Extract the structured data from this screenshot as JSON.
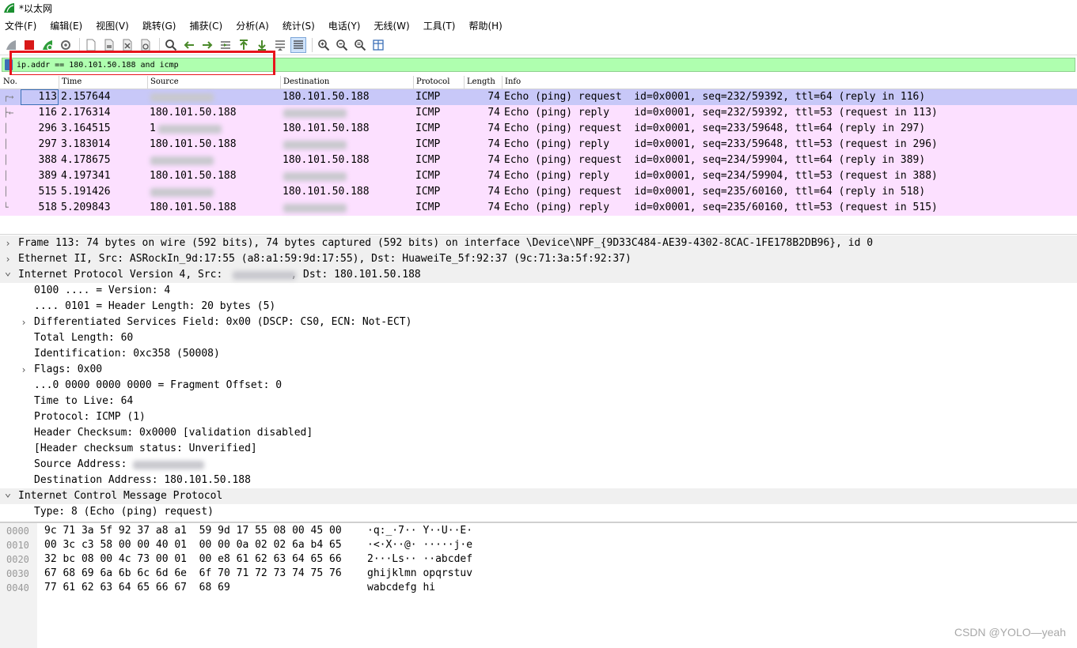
{
  "window": {
    "title": "*以太网"
  },
  "menu": [
    "文件(F)",
    "编辑(E)",
    "视图(V)",
    "跳转(G)",
    "捕获(C)",
    "分析(A)",
    "统计(S)",
    "电话(Y)",
    "无线(W)",
    "工具(T)",
    "帮助(H)"
  ],
  "filter": {
    "value": "ip.addr == 180.101.50.188 and icmp"
  },
  "columns": {
    "no": "No.",
    "time": "Time",
    "source": "Source",
    "destination": "Destination",
    "protocol": "Protocol",
    "length": "Length",
    "info": "Info"
  },
  "colors": {
    "selected_row": "#c8c8f8",
    "icmp_row": "#fce0ff",
    "filter_valid": "#afffaf",
    "highlight_box": "#e8141b"
  },
  "packets": [
    {
      "no": "113",
      "time": "2.157644",
      "source": "",
      "destination": "180.101.50.188",
      "protocol": "ICMP",
      "length": "74",
      "info": "Echo (ping) request  id=0x0001, seq=232/59392, ttl=64 (reply in 116)",
      "selected": true
    },
    {
      "no": "116",
      "time": "2.176314",
      "source": "180.101.50.188",
      "destination": "",
      "protocol": "ICMP",
      "length": "74",
      "info": "Echo (ping) reply    id=0x0001, seq=232/59392, ttl=53 (request in 113)",
      "selected": false
    },
    {
      "no": "296",
      "time": "3.164515",
      "source": "1",
      "destination": "180.101.50.188",
      "protocol": "ICMP",
      "length": "74",
      "info": "Echo (ping) request  id=0x0001, seq=233/59648, ttl=64 (reply in 297)",
      "selected": false
    },
    {
      "no": "297",
      "time": "3.183014",
      "source": "180.101.50.188",
      "destination": "",
      "protocol": "ICMP",
      "length": "74",
      "info": "Echo (ping) reply    id=0x0001, seq=233/59648, ttl=53 (request in 296)",
      "selected": false
    },
    {
      "no": "388",
      "time": "4.178675",
      "source": "",
      "destination": "180.101.50.188",
      "protocol": "ICMP",
      "length": "74",
      "info": "Echo (ping) request  id=0x0001, seq=234/59904, ttl=64 (reply in 389)",
      "selected": false
    },
    {
      "no": "389",
      "time": "4.197341",
      "source": "180.101.50.188",
      "destination": "",
      "protocol": "ICMP",
      "length": "74",
      "info": "Echo (ping) reply    id=0x0001, seq=234/59904, ttl=53 (request in 388)",
      "selected": false
    },
    {
      "no": "515",
      "time": "5.191426",
      "source": "",
      "destination": "180.101.50.188",
      "protocol": "ICMP",
      "length": "74",
      "info": "Echo (ping) request  id=0x0001, seq=235/60160, ttl=64 (reply in 518)",
      "selected": false
    },
    {
      "no": "518",
      "time": "5.209843",
      "source": "180.101.50.188",
      "destination": "",
      "protocol": "ICMP",
      "length": "74",
      "info": "Echo (ping) reply    id=0x0001, seq=235/60160, ttl=53 (request in 515)",
      "selected": false
    }
  ],
  "details": [
    {
      "text": "Frame 113: 74 bytes on wire (592 bits), 74 bytes captured (592 bits) on interface \\Device\\NPF_{9D33C484-AE39-4302-8CAC-1FE178B2DB96}, id 0",
      "level": 0,
      "toggle": "collapsed"
    },
    {
      "text": "Ethernet II, Src: ASRockIn_9d:17:55 (a8:a1:59:9d:17:55), Dst: HuaweiTe_5f:92:37 (9c:71:3a:5f:92:37)",
      "level": 0,
      "toggle": "collapsed"
    },
    {
      "text": "Internet Protocol Version 4, Src:           , Dst: 180.101.50.188",
      "level": 0,
      "toggle": "expanded"
    },
    {
      "text": "0100 .... = Version: 4",
      "level": 1,
      "toggle": "none"
    },
    {
      "text": ".... 0101 = Header Length: 20 bytes (5)",
      "level": 1,
      "toggle": "none"
    },
    {
      "text": "Differentiated Services Field: 0x00 (DSCP: CS0, ECN: Not-ECT)",
      "level": 1,
      "toggle": "collapsed"
    },
    {
      "text": "Total Length: 60",
      "level": 1,
      "toggle": "none"
    },
    {
      "text": "Identification: 0xc358 (50008)",
      "level": 1,
      "toggle": "none"
    },
    {
      "text": "Flags: 0x00",
      "level": 1,
      "toggle": "collapsed"
    },
    {
      "text": "...0 0000 0000 0000 = Fragment Offset: 0",
      "level": 1,
      "toggle": "none"
    },
    {
      "text": "Time to Live: 64",
      "level": 1,
      "toggle": "none"
    },
    {
      "text": "Protocol: ICMP (1)",
      "level": 1,
      "toggle": "none"
    },
    {
      "text": "Header Checksum: 0x0000 [validation disabled]",
      "level": 1,
      "toggle": "none"
    },
    {
      "text": "[Header checksum status: Unverified]",
      "level": 1,
      "toggle": "none"
    },
    {
      "text": "Source Address: ",
      "level": 1,
      "toggle": "none"
    },
    {
      "text": "Destination Address: 180.101.50.188",
      "level": 1,
      "toggle": "none"
    },
    {
      "text": "Internet Control Message Protocol",
      "level": 0,
      "toggle": "expanded"
    },
    {
      "text": "Type: 8 (Echo (ping) request)",
      "level": 1,
      "toggle": "none"
    }
  ],
  "bytes": [
    {
      "offset": "0000",
      "hex": "9c 71 3a 5f 92 37 a8 a1  59 9d 17 55 08 00 45 00",
      "ascii": "·q:_·7·· Y··U··E·"
    },
    {
      "offset": "0010",
      "hex": "00 3c c3 58 00 00 40 01  00 00 0a 02 02 6a b4 65",
      "ascii": "·<·X··@· ·····j·e"
    },
    {
      "offset": "0020",
      "hex": "32 bc 08 00 4c 73 00 01  00 e8 61 62 63 64 65 66",
      "ascii": "2···Ls·· ··abcdef"
    },
    {
      "offset": "0030",
      "hex": "67 68 69 6a 6b 6c 6d 6e  6f 70 71 72 73 74 75 76",
      "ascii": "ghijklmn opqrstuv"
    },
    {
      "offset": "0040",
      "hex": "77 61 62 63 64 65 66 67  68 69",
      "ascii": "wabcdefg hi"
    }
  ],
  "watermark": "CSDN @YOLO—yeah"
}
